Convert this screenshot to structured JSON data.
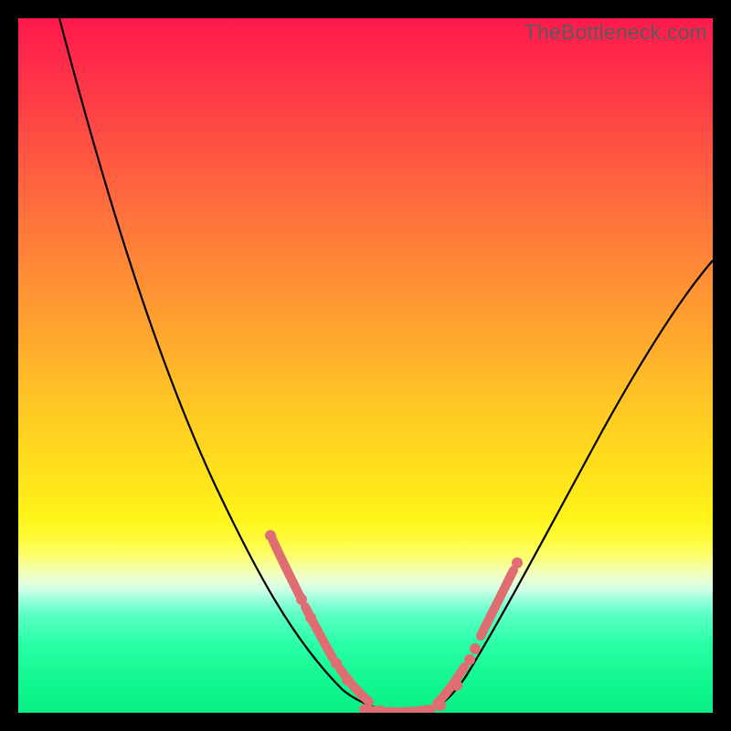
{
  "watermark": "TheBottleneck.com",
  "colors": {
    "curve": "#000000",
    "beads": "#de6e72",
    "frame": "#000000"
  },
  "chart_data": {
    "type": "line",
    "title": "",
    "xlabel": "",
    "ylabel": "",
    "xlim": [
      0,
      100
    ],
    "ylim": [
      0,
      100
    ],
    "grid": false,
    "legend": false,
    "series": [
      {
        "name": "bottleneck-curve",
        "x": [
          5,
          10,
          15,
          20,
          25,
          30,
          35,
          40,
          44,
          47,
          50,
          53,
          56,
          60,
          64,
          68,
          72,
          78,
          85,
          92,
          100
        ],
        "y": [
          100,
          86,
          72,
          58,
          46,
          36,
          27,
          19,
          12,
          7,
          3,
          1,
          0,
          0,
          3,
          9,
          17,
          28,
          41,
          53,
          64
        ]
      }
    ],
    "highlighted_segments": [
      {
        "side": "left",
        "x_range": [
          36,
          56
        ],
        "approx_y_range": [
          0,
          25
        ]
      },
      {
        "side": "right",
        "x_range": [
          56,
          70
        ],
        "approx_y_range": [
          0,
          25
        ]
      }
    ],
    "note": "Values estimated from pixel positions; chart has no visible axis ticks or labels."
  }
}
